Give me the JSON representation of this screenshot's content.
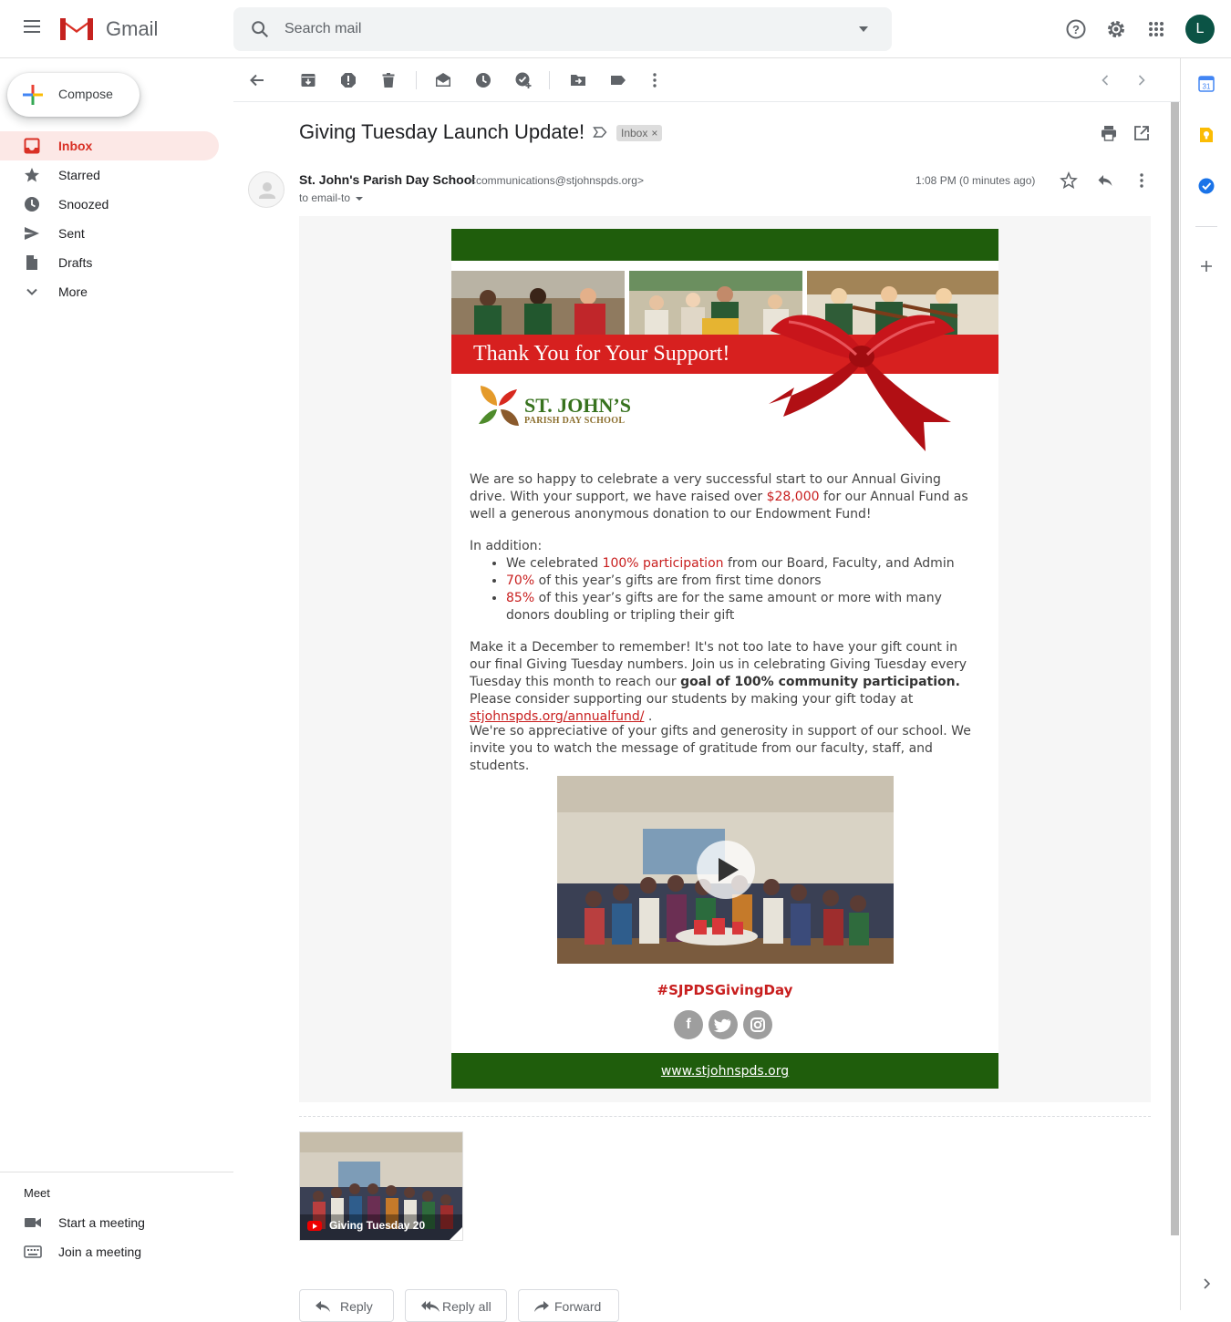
{
  "app": {
    "name": "Gmail",
    "search_placeholder": "Search mail",
    "avatar_letter": "L",
    "avatar_color": "#0b5345"
  },
  "sidebar": {
    "compose_label": "Compose",
    "items": [
      {
        "label": "Inbox",
        "icon": "inbox-icon",
        "active": true
      },
      {
        "label": "Starred",
        "icon": "star-icon"
      },
      {
        "label": "Snoozed",
        "icon": "clock-icon"
      },
      {
        "label": "Sent",
        "icon": "send-icon"
      },
      {
        "label": "Drafts",
        "icon": "draft-icon"
      },
      {
        "label": "More",
        "icon": "chevron-down-icon"
      }
    ],
    "meet": {
      "title": "Meet",
      "start": "Start a meeting",
      "join": "Join a meeting"
    }
  },
  "message": {
    "subject": "Giving Tuesday Launch Update!",
    "label_chip": "Inbox",
    "sender_name": "St. John's Parish Day School",
    "sender_email": "<communications@stjohnspds.org>",
    "to": "to email-to",
    "time": "1:08 PM (0 minutes ago)"
  },
  "email": {
    "banner_text": "Thank You for Your Support!",
    "school_name": "ST. JOHN’S",
    "school_sub": "PARISH DAY SCHOOL",
    "p1_a": "We are so happy to celebrate a very successful start to our Annual Giving drive. With your support, we have raised over ",
    "p1_amount": "$28,000",
    "p1_b": " for our Annual Fund as well a generous anonymous donation to our Endowment Fund!",
    "in_addition": "In addition:",
    "b1_a": "We celebrated ",
    "b1_red": "100% participation",
    "b1_b": " from our Board, Faculty, and Admin",
    "b2_red": "70%",
    "b2_b": " of this year’s gifts are from first time donors",
    "b3_red": "85%",
    "b3_b": " of this year’s gifts are for the same amount or more with many donors doubling or tripling their gift",
    "p3_a": "Make it a December to remember! It's not too late to have your gift count in our final Giving Tuesday numbers. Join us in celebrating Giving Tuesday every Tuesday this month to reach our ",
    "p3_bold": "goal of 100% community participation.",
    "p3_b": " Please consider supporting our students by making your gift today at ",
    "p3_link": "stjohnspds.org/annualfund/",
    "p3_end": " .",
    "p4": "We're so appreciative of your gifts and generosity in support of our school. We invite you to watch the message of gratitude from our faculty, staff, and students.",
    "hashtag": "#SJPDSGivingDay",
    "social": [
      "f",
      "t",
      "ig"
    ],
    "footer_link": "www.stjohnspds.org",
    "brand_green": "#1f5d0c",
    "accent_red": "#c81e1e"
  },
  "attachment": {
    "title": "Giving Tuesday 20"
  },
  "actions": {
    "reply": "Reply",
    "reply_all": "Reply all",
    "forward": "Forward"
  }
}
